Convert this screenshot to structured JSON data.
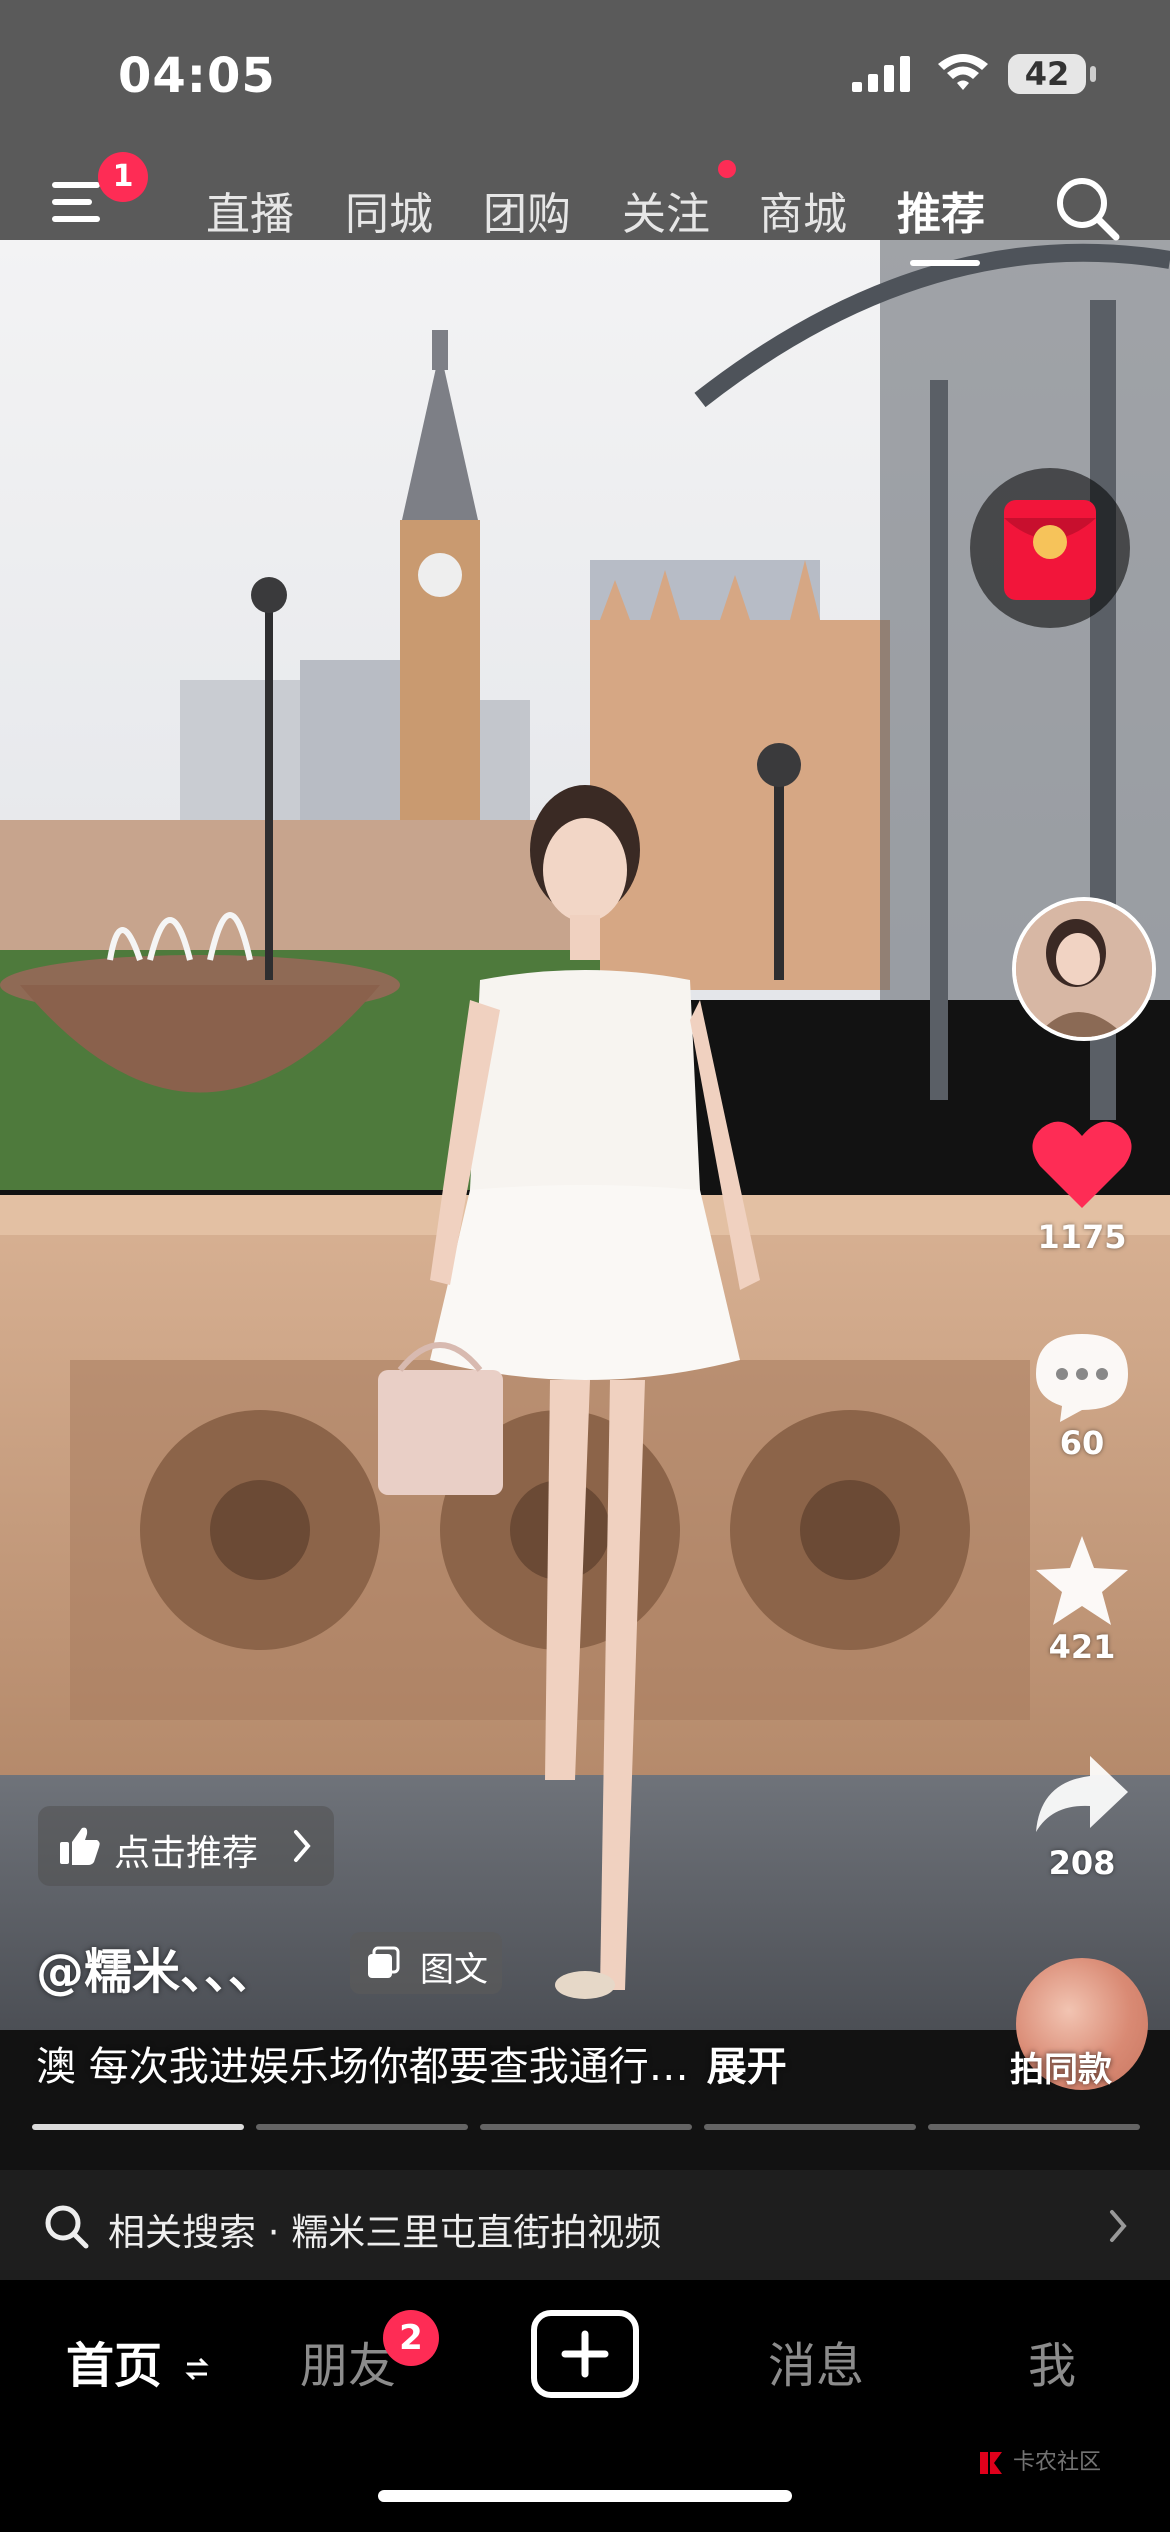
{
  "status_bar": {
    "time": "04:05",
    "battery": "42"
  },
  "top_nav": {
    "menu_badge": "1",
    "tabs": [
      {
        "label": "直播"
      },
      {
        "label": "同城"
      },
      {
        "label": "团购"
      },
      {
        "label": "关注",
        "dot": true
      },
      {
        "label": "商城"
      },
      {
        "label": "推荐",
        "active": true
      }
    ]
  },
  "actions": {
    "likes": "1175",
    "comments": "60",
    "favorites": "421",
    "shares": "208",
    "same_style": "拍同款"
  },
  "post": {
    "recommend_label": "点击推荐",
    "author": "@糯米、、、",
    "type_tag": "图文",
    "caption": "澳 每次我进娱乐场你都要查我通行…",
    "expand_label": "展开",
    "pages_total": 5,
    "current_page": 1
  },
  "related_search": {
    "text": "相关搜索 · 糯米三里屯直街拍视频"
  },
  "tab_bar": {
    "home": "首页",
    "friends": "朋友",
    "friends_badge": "2",
    "messages": "消息",
    "me": "我"
  },
  "watermark": "卡农社区",
  "colors": {
    "accent": "#fe2c55",
    "like": "#fe2c55"
  }
}
